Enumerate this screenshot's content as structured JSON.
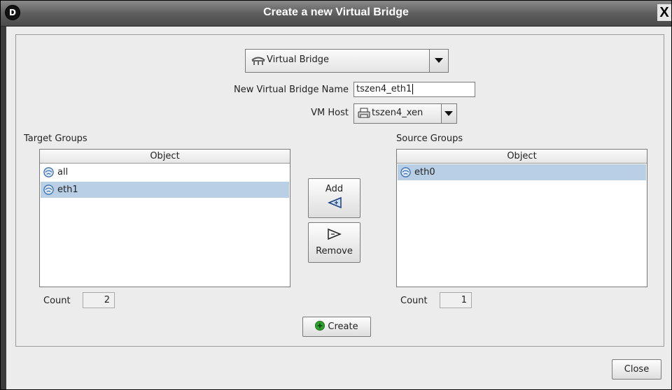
{
  "window": {
    "title": "Create a new Virtual Bridge",
    "logo_letter": "D",
    "close_glyph": "X"
  },
  "type_combo": {
    "selected": "Virtual Bridge",
    "icon": "bridge-icon"
  },
  "form": {
    "name_label": "New Virtual Bridge Name",
    "name_value": "tszen4_eth1",
    "host_label": "VM Host",
    "host_value": "tszen4_xen"
  },
  "target_groups": {
    "label": "Target Groups",
    "column": "Object",
    "rows": [
      {
        "name": "all",
        "selected": false
      },
      {
        "name": "eth1",
        "selected": true
      }
    ],
    "count_label": "Count",
    "count": "2"
  },
  "source_groups": {
    "label": "Source Groups",
    "column": "Object",
    "rows": [
      {
        "name": "eth0",
        "selected": true
      }
    ],
    "count_label": "Count",
    "count": "1"
  },
  "buttons": {
    "add": "Add",
    "remove": "Remove",
    "create": "Create",
    "close": "Close"
  },
  "colors": {
    "selection": "#b8cfe5",
    "titlebar": "#5f5f5f",
    "create_icon": "#2fa52f"
  }
}
